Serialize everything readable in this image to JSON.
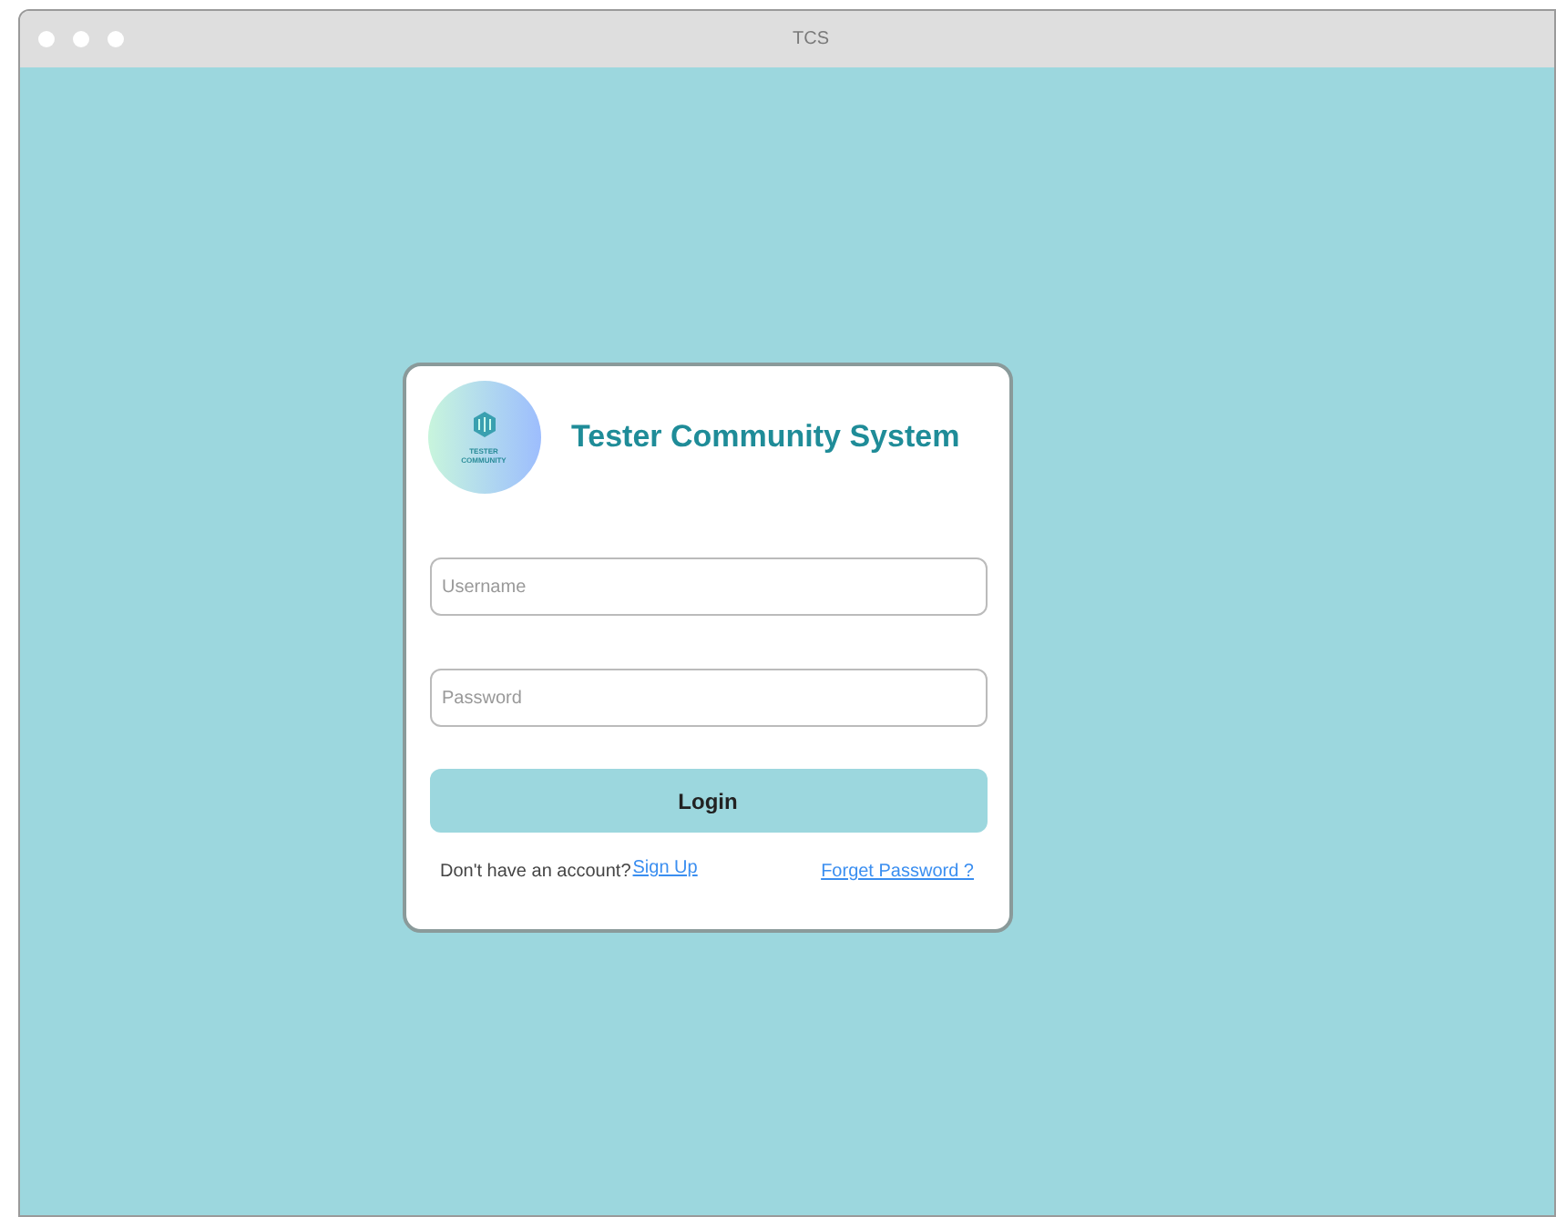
{
  "window": {
    "title": "TCS"
  },
  "logo": {
    "lines": [
      "TESTER",
      "COMMUNITY"
    ]
  },
  "heading": "Tester Community System",
  "fields": [
    {
      "placeholder": "Username"
    },
    {
      "placeholder": "Password"
    }
  ],
  "login_button": "Login",
  "signup_prompt": "Don't have an account?",
  "signup_link": "Sign Up",
  "forgot_link": "Forget Password ?"
}
